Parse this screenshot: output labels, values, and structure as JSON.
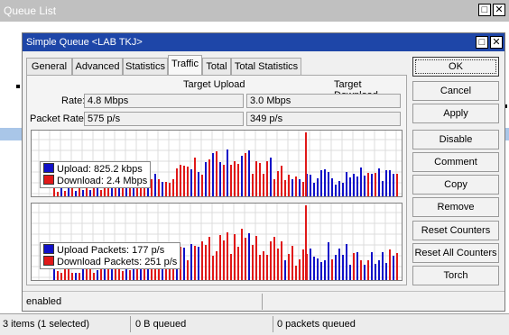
{
  "window": {
    "title": "Queue List",
    "restore_glyph": "□",
    "close_glyph": "✕"
  },
  "status_bar": {
    "items_count": "3 items (1 selected)",
    "queued_bytes": "0 B queued",
    "queued_packets": "0 packets queued"
  },
  "dialog": {
    "title": "Simple Queue <LAB TKJ>",
    "restore_glyph": "□",
    "close_glyph": "✕",
    "tabs": [
      {
        "label": "General"
      },
      {
        "label": "Advanced"
      },
      {
        "label": "Statistics"
      },
      {
        "label": "Traffic",
        "active": true
      },
      {
        "label": "Total"
      },
      {
        "label": "Total Statistics"
      }
    ],
    "traffic": {
      "target_upload_header": "Target Upload",
      "target_download_header": "Target Download",
      "rate_label": "Rate:",
      "rate_upload": "4.8 Mbps",
      "rate_download": "3.0 Mbps",
      "packet_rate_label": "Packet Rate:",
      "packet_rate_upload": "575 p/s",
      "packet_rate_download": "349 p/s",
      "graph_bits": {
        "legend_upload": "Upload:  825.2 kbps",
        "legend_download": "Download:  2.4 Mbps"
      },
      "graph_packets": {
        "legend_upload": "Upload Packets:  177 p/s",
        "legend_download": "Download Packets:  251 p/s"
      }
    },
    "buttons": {
      "ok": "OK",
      "cancel": "Cancel",
      "apply": "Apply",
      "disable": "Disable",
      "comment": "Comment",
      "copy": "Copy",
      "remove": "Remove",
      "reset_counters": "Reset Counters",
      "reset_all_counters": "Reset All Counters",
      "torch": "Torch"
    },
    "status": "enabled"
  },
  "colors": {
    "upload": "#1010c8",
    "download": "#e01818",
    "title_bar": "#1e46a8"
  }
}
